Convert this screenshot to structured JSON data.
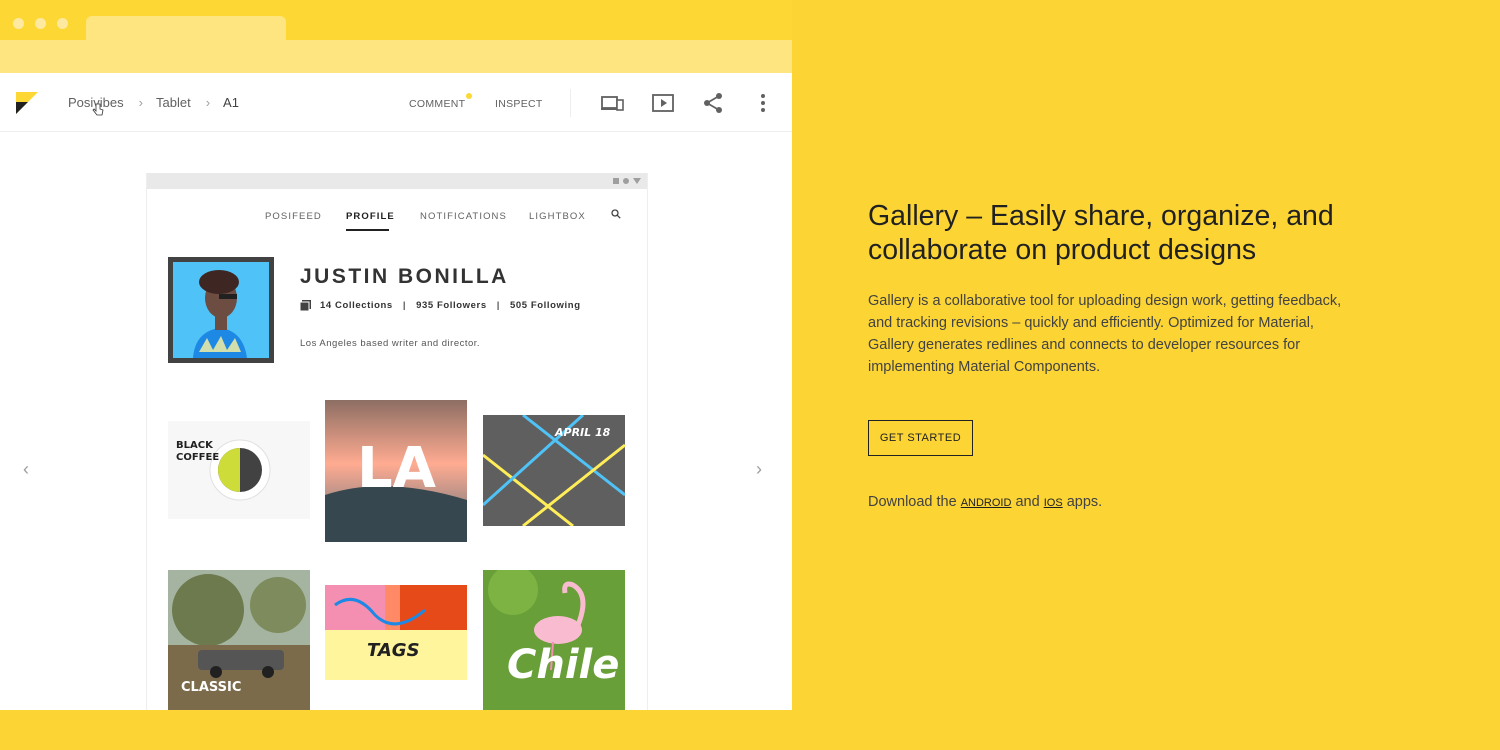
{
  "colors": {
    "brand_yellow": "#FCD535",
    "text_dark": "#212121"
  },
  "breadcrumb": {
    "items": [
      "Posivibes",
      "Tablet",
      "A1"
    ]
  },
  "toolbar": {
    "comment_label": "COMMENT",
    "inspect_label": "INSPECT",
    "icons": [
      "devices-icon",
      "present-icon",
      "share-icon",
      "more-vert-icon"
    ]
  },
  "preview": {
    "nav": [
      "POSIFEED",
      "PROFILE",
      "NOTIFICATIONS",
      "LIGHTBOX"
    ],
    "active_nav": "PROFILE",
    "profile": {
      "name": "JUSTIN BONILLA",
      "collections": "14 Collections",
      "followers": "935 Followers",
      "following": "505 Following",
      "bio": "Los Angeles based writer and director."
    },
    "tiles": {
      "coffee": "BLACK\nCOFFEE",
      "la": "LA",
      "april": "APRIL 18",
      "classic": "CLASSIC",
      "tags": "TAGS",
      "chile": "Chile"
    }
  },
  "hero": {
    "title": "Gallery – Easily share, organize, and collaborate on product designs",
    "description": "Gallery is a collaborative tool for uploading design work, getting feedback, and tracking revisions – quickly and efficiently. Optimized for Material, Gallery generates redlines and connects to developer resources for implementing Material Components.",
    "cta_label": "GET STARTED",
    "download_prefix": "Download the",
    "android_label": "ANDROID",
    "and_label": "and",
    "ios_label": "IOS",
    "download_suffix": "apps."
  }
}
